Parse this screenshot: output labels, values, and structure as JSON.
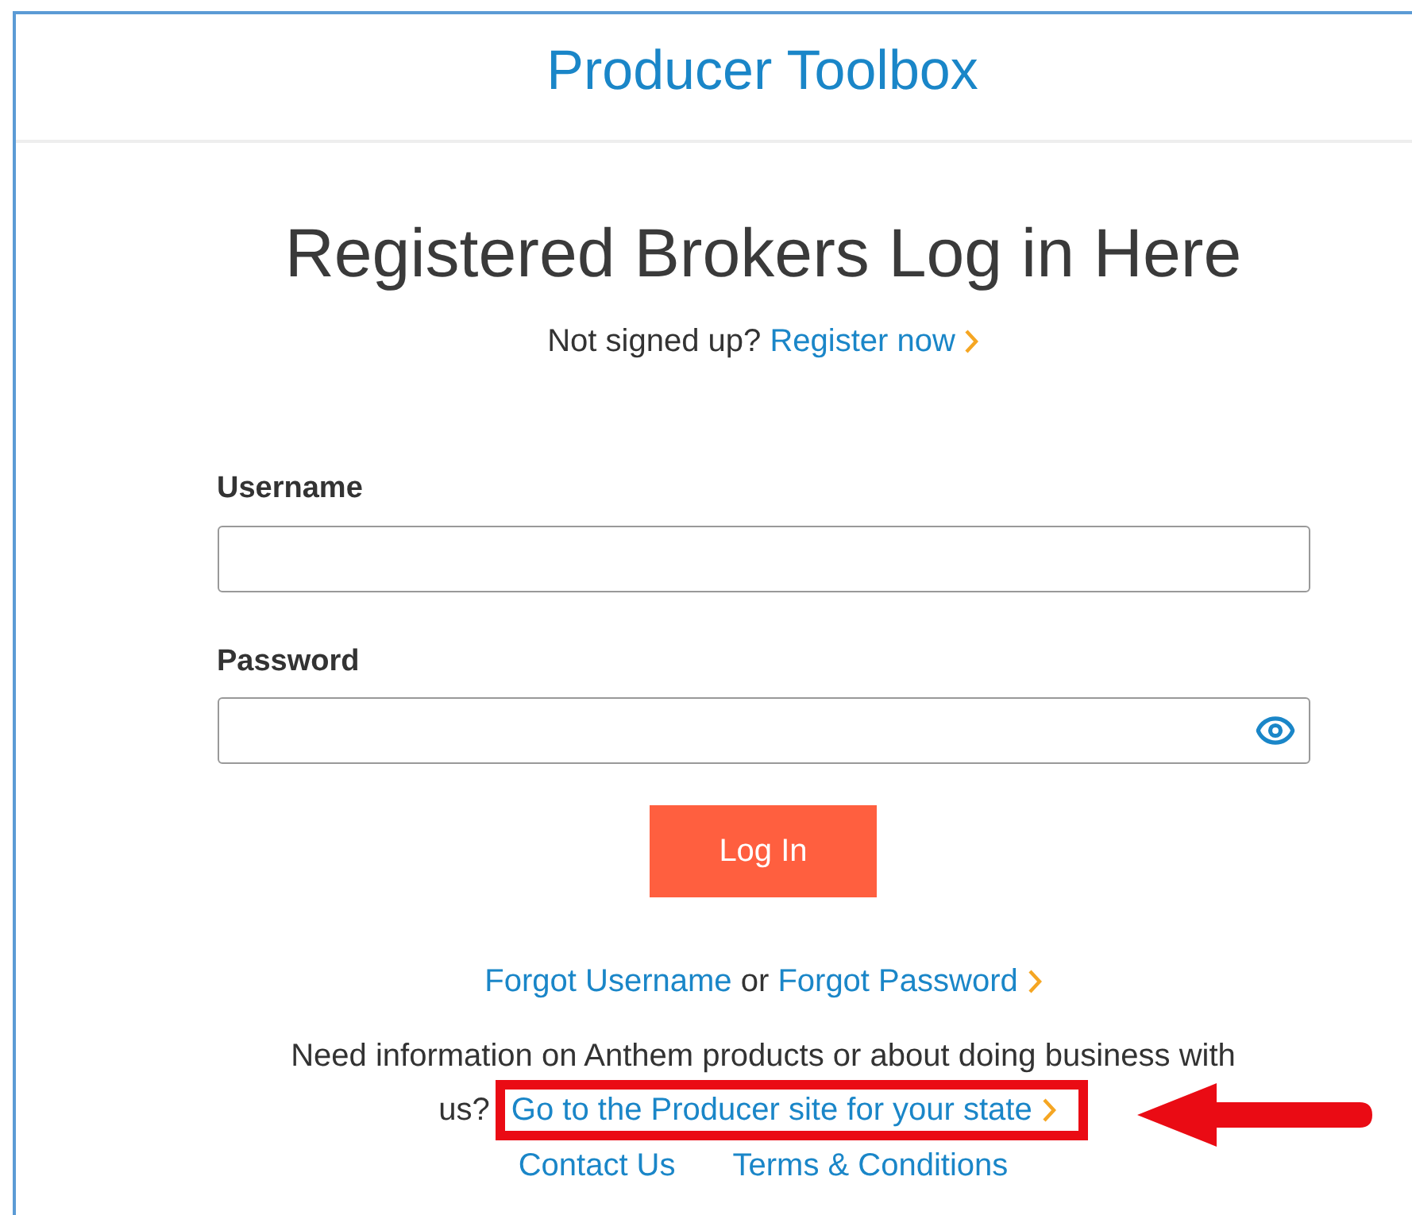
{
  "header": {
    "title": "Producer Toolbox"
  },
  "heading": "Registered Brokers Log in Here",
  "signup": {
    "prompt": "Not signed up?",
    "link": "Register now"
  },
  "fields": [
    {
      "label": "Username",
      "kind": "text"
    },
    {
      "label": "Password",
      "kind": "password"
    }
  ],
  "login_button": "Log In",
  "recovery": {
    "username_link": "Forgot Username",
    "separator": "or",
    "password_link": "Forgot Password"
  },
  "info": {
    "text": "Need information on Anthem products or about doing business with us?",
    "link": "Go to the Producer site for your state"
  },
  "footer_links": [
    "Contact Us",
    "Terms & Conditions"
  ]
}
